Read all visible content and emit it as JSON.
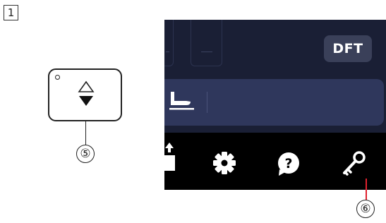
{
  "step": {
    "number": "1"
  },
  "callouts": {
    "key_label": "⑤",
    "icon_label": "⑥"
  },
  "screen": {
    "dft_label": "DFT"
  },
  "colors": {
    "leader_red": "#e0212e",
    "panel_navy": "#2f375c",
    "panel_dark": "#1a1f35",
    "button_gray": "#3a4059"
  },
  "icons": {
    "key_arrows": "up-down-arrow-icon",
    "foot": "presser-foot-icon",
    "settings": "gear-icon",
    "help": "help-icon",
    "lock": "key-icon"
  }
}
